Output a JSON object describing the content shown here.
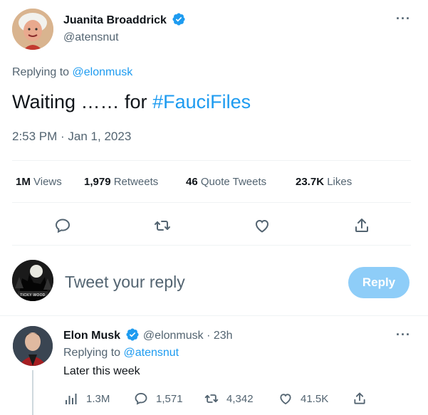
{
  "main_tweet": {
    "author_name": "Juanita Broaddrick",
    "author_handle": "@atensnut",
    "replying_prefix": "Replying to",
    "replying_to": "@elonmusk",
    "text_main": "Waiting …… for",
    "hashtag": "#FauciFiles",
    "timestamp": "2:53 PM · Jan 1, 2023",
    "more_label": "···"
  },
  "stats": {
    "views_count": "1M",
    "views_label": "Views",
    "retweets_count": "1,979",
    "retweets_label": "Retweets",
    "quotes_count": "46",
    "quotes_label": "Quote Tweets",
    "likes_count": "23.7K",
    "likes_label": "Likes"
  },
  "actions": [
    "reply-icon",
    "retweet-icon",
    "like-icon",
    "share-icon"
  ],
  "composer": {
    "placeholder": "Tweet your reply",
    "reply_button": "Reply",
    "avatar_badge": "TICKY WOOD"
  },
  "reply_tweet": {
    "author_name": "Elon Musk",
    "author_handle": "@elonmusk",
    "separator": "·",
    "age": "23h",
    "replying_prefix": "Replying to",
    "replying_to": "@atensnut",
    "text": "Later this week",
    "views": "1.3M",
    "replies": "1,571",
    "retweets": "4,342",
    "likes": "41.5K",
    "more_label": "···"
  },
  "colors": {
    "accent": "#1d9bf0",
    "reply_button_disabled": "#8ecdf8",
    "muted_text": "#536471",
    "divider": "#eff3f4"
  }
}
